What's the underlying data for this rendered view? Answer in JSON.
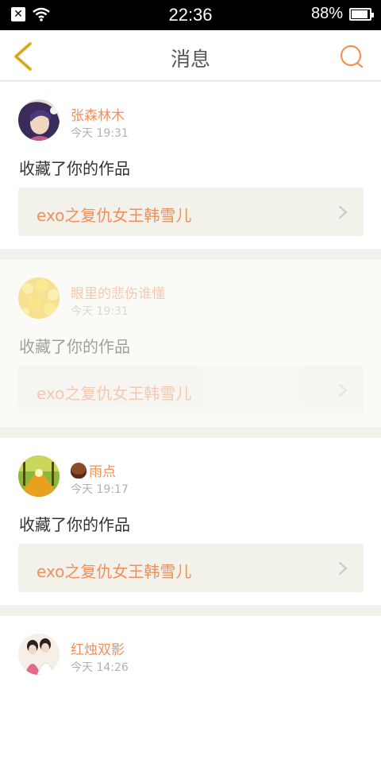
{
  "status_bar": {
    "time": "22:36",
    "battery": "88%"
  },
  "header": {
    "title": "消息",
    "back_icon": "chevron-left-icon",
    "search_icon": "search-icon",
    "accent_color": "#f0905a"
  },
  "messages": [
    {
      "username": "张森林木",
      "time": "今天 19:31",
      "action": "收藏了你的作品",
      "work_title": "exo之复仇女王韩雪儿",
      "avatar": "anime-girl-avatar",
      "faded": false
    },
    {
      "username": "眼里的悲伤谁懂",
      "time": "今天 19:31",
      "action": "收藏了你的作品",
      "work_title": "exo之复仇女王韩雪儿",
      "avatar": "yellow-flowers-avatar",
      "faded": true
    },
    {
      "username": "雨点",
      "username_icon": "chestnut-emoji-icon",
      "time": "今天 19:17",
      "action": "收藏了你的作品",
      "work_title": "exo之复仇女王韩雪儿",
      "avatar": "autumn-forest-avatar",
      "faded": false
    },
    {
      "username": "红烛双影",
      "time": "今天 14:26",
      "avatar": "ancient-couple-avatar",
      "faded": false
    }
  ]
}
